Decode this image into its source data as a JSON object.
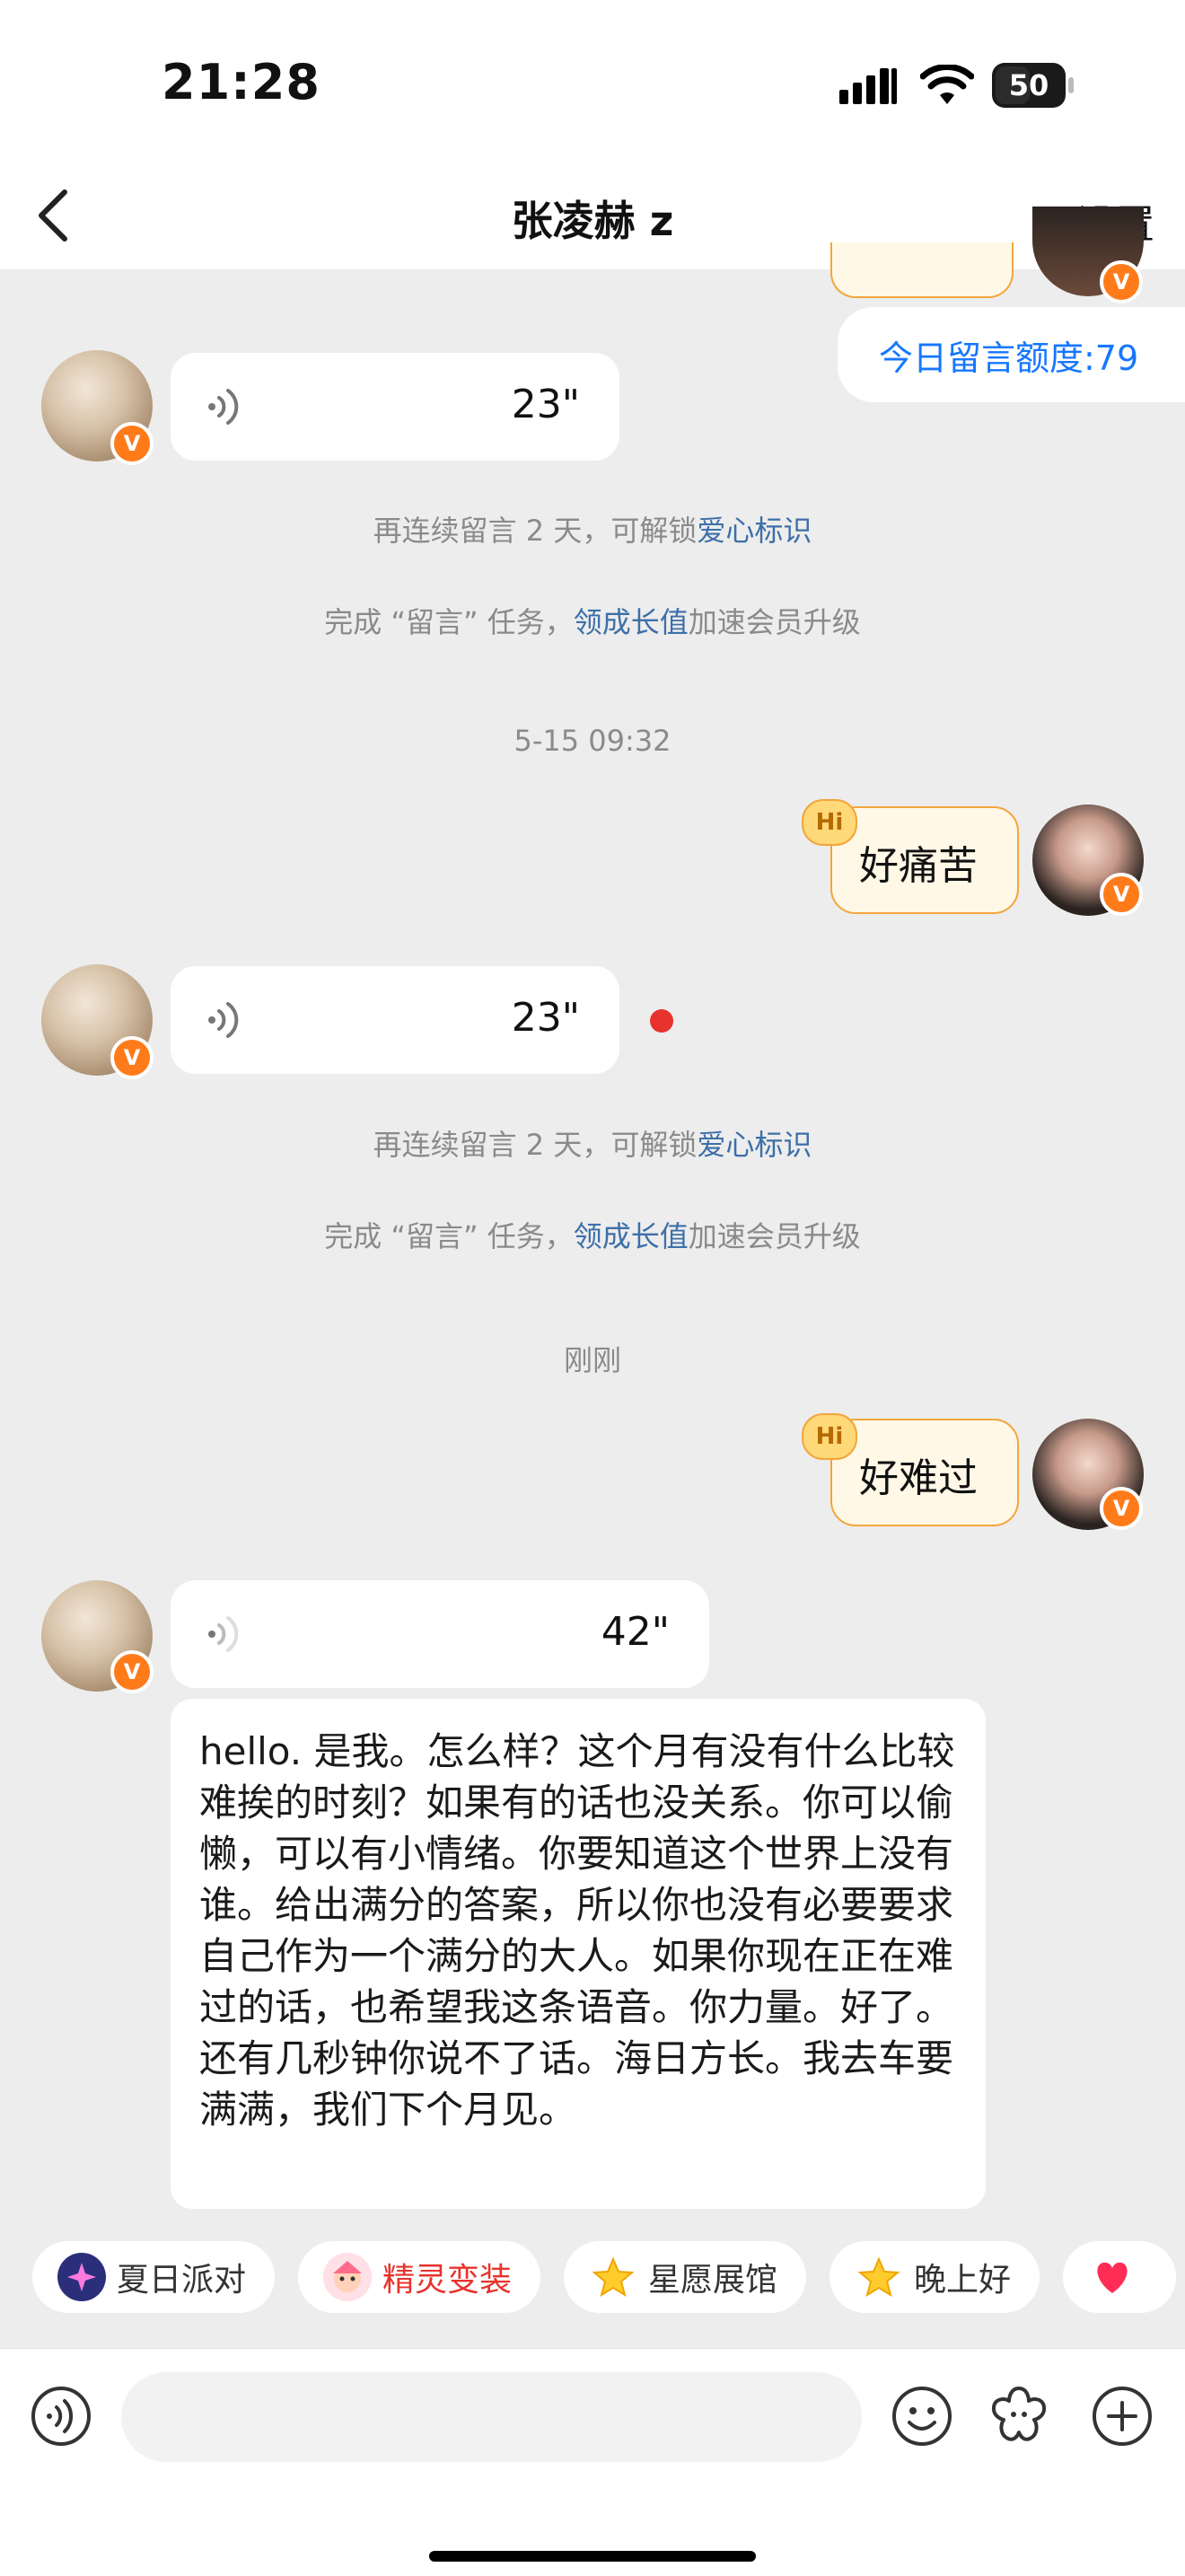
{
  "status": {
    "time": "21:28",
    "battery": "50"
  },
  "header": {
    "title": "张凌赫 z",
    "settings_label": "设置"
  },
  "colors": {
    "accent": "#3d6fa8",
    "orange": "#ff7b1a",
    "unread": "#e8322c",
    "quota": "#1677ff"
  },
  "quota": {
    "text": "今日留言额度:79"
  },
  "messages": {
    "voice1": {
      "duration": "23\""
    },
    "system1": {
      "prefix": "再连续留言 2 天，可解锁",
      "link": "爱心标识"
    },
    "system2": {
      "prefix": "完成 “留言” 任务，",
      "link": "领成长值",
      "suffix": "加速会员升级"
    },
    "timestamp1": "5-15 09:32",
    "sent1": {
      "badge": "Hi",
      "text": "好痛苦"
    },
    "voice2": {
      "duration": "23\""
    },
    "system3": {
      "prefix": "再连续留言 2 天，可解锁",
      "link": "爱心标识"
    },
    "system4": {
      "prefix": "完成 “留言” 任务，",
      "link": "领成长值",
      "suffix": "加速会员升级"
    },
    "timestamp2": "刚刚",
    "sent2": {
      "badge": "Hi",
      "text": "好难过"
    },
    "voice3": {
      "duration": "42\""
    },
    "transcript": "hello. 是我。怎么样？这个月有没有什么比较难挨的时刻？如果有的话也没关系。你可以偷懒，可以有小情绪。你要知道这个世界上没有谁。给出满分的答案，所以你也没有必要要求自己作为一个满分的大人。如果你现在正在难过的话，也希望我这条语音。你力量。好了。还有几秒钟你说不了话。海日方长。我去车要满满，我们下个月见。"
  },
  "chips": [
    {
      "label": "夏日派对",
      "icon": "sparkle-star-icon"
    },
    {
      "label": "精灵变装",
      "icon": "elf-face-icon"
    },
    {
      "label": "星愿展馆",
      "icon": "star-icon"
    },
    {
      "label": "晚上好",
      "icon": "star-icon"
    },
    {
      "label": "",
      "icon": "heart-icon"
    }
  ]
}
